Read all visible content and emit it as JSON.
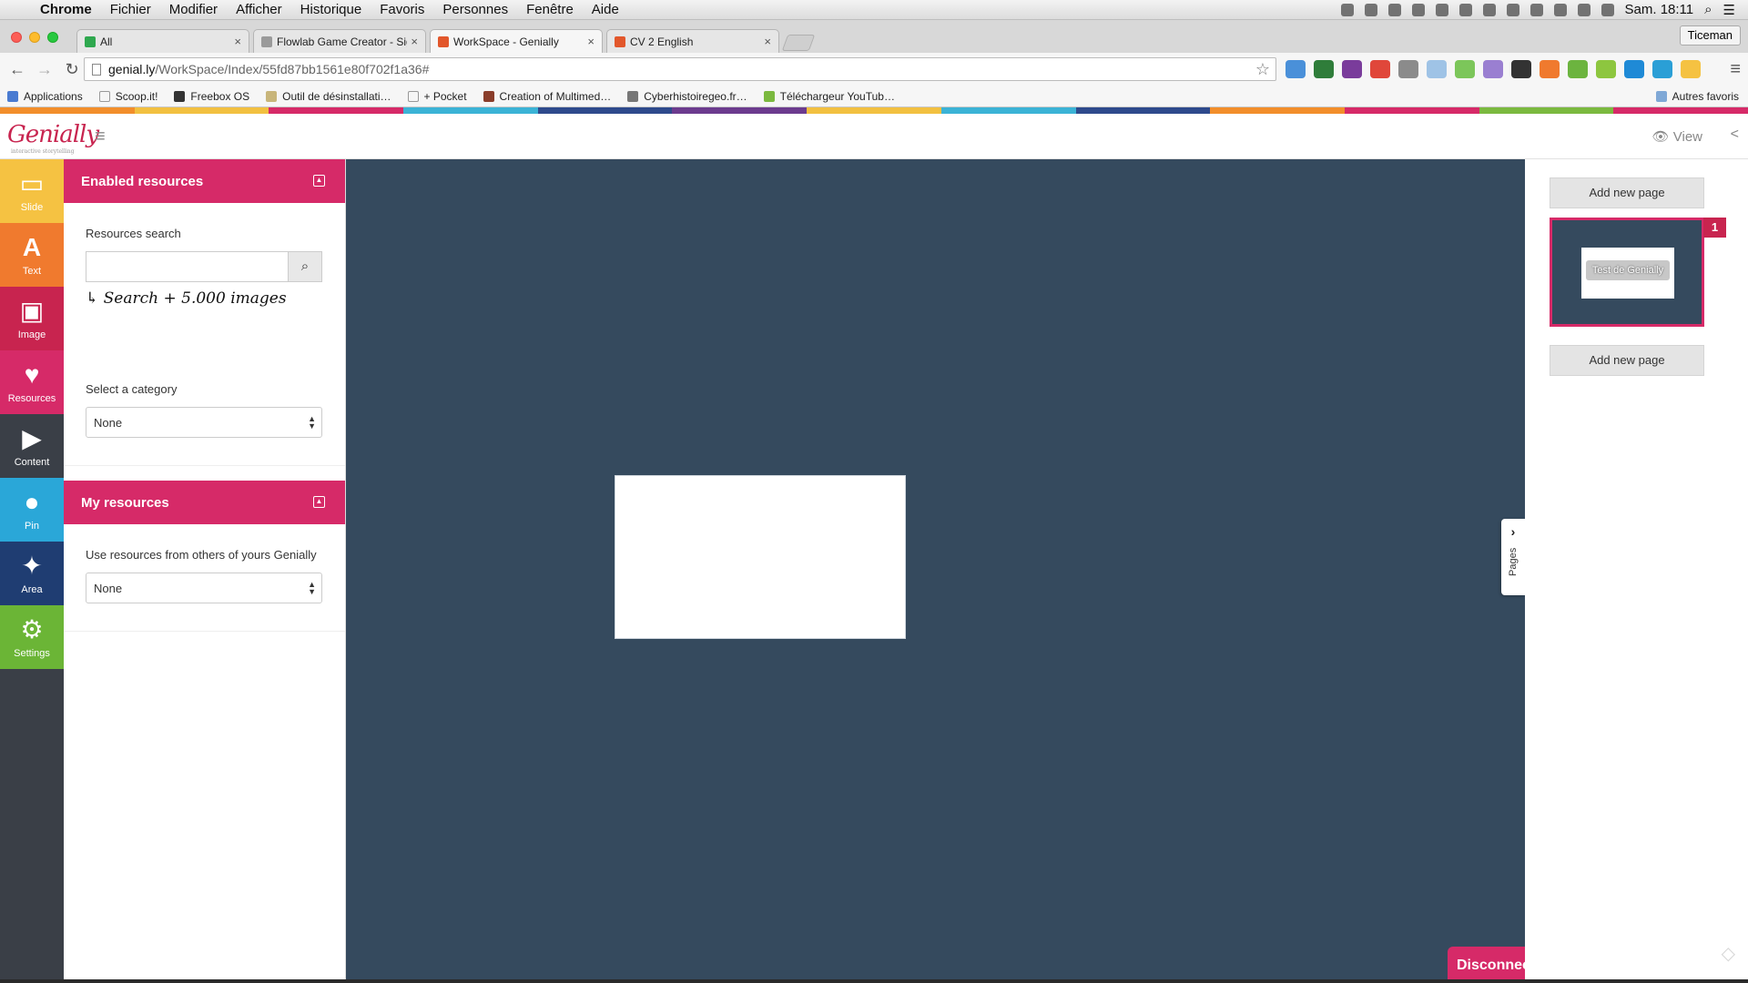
{
  "macos": {
    "menus": [
      "Chrome",
      "Fichier",
      "Modifier",
      "Afficher",
      "Historique",
      "Favoris",
      "Personnes",
      "Fenêtre",
      "Aide"
    ],
    "clock": "Sam. 18:11"
  },
  "browser": {
    "tabs": [
      {
        "label": "All",
        "favicon_color": "#2fa84f"
      },
      {
        "label": "Flowlab Game Creator - Sig",
        "favicon_color": "#9a9a9a"
      },
      {
        "label": "WorkSpace - Genially",
        "favicon_color": "#e2572b"
      },
      {
        "label": "CV 2 English",
        "favicon_color": "#e2572b"
      }
    ],
    "profile": "Ticeman",
    "url_host": "genial.ly",
    "url_path": "/WorkSpace/Index/55fd87bb1561e80f702f1a36#",
    "bookmarks": [
      {
        "label": "Applications",
        "color": "#4a7bd1"
      },
      {
        "label": "Scoop.it!",
        "color": "#ffffff"
      },
      {
        "label": "Freebox OS",
        "color": "#333333"
      },
      {
        "label": "Outil de désinstallati…",
        "color": "#c8b57a"
      },
      {
        "label": "+ Pocket",
        "color": "#ffffff"
      },
      {
        "label": "Creation of Multimed…",
        "color": "#8a3d2a"
      },
      {
        "label": "Cyberhistoiregeo.fr…",
        "color": "#777777"
      },
      {
        "label": "Téléchargeur YouTub…",
        "color": "#7bb93f"
      }
    ],
    "bookmarks_right": "Autres favoris"
  },
  "app": {
    "logo": "Genially",
    "logo_tagline": "interactive storytelling",
    "view_label": "View",
    "color_strip": [
      "#f28e2b",
      "#f2c040",
      "#d62a68",
      "#3bb3d6",
      "#2e4a8c",
      "#6c3b8e",
      "#f2c040",
      "#3bb3d6",
      "#2e4a8c",
      "#f28e2b",
      "#d62a68",
      "#7bb93f",
      "#d62a68"
    ],
    "rail": [
      {
        "label": "Slide",
        "icon": "▭",
        "color": "#f5c242"
      },
      {
        "label": "Text",
        "icon": "A",
        "color": "#f07a2e"
      },
      {
        "label": "Image",
        "icon": "▣",
        "color": "#c8244f"
      },
      {
        "label": "Resources",
        "icon": "♥",
        "color": "#d62a68"
      },
      {
        "label": "Content",
        "icon": "▶",
        "color": "#3a3f47"
      },
      {
        "label": "Pin",
        "icon": "●",
        "color": "#2aa7d8"
      },
      {
        "label": "Area",
        "icon": "✦",
        "color": "#1f3d72"
      },
      {
        "label": "Settings",
        "icon": "⚙",
        "color": "#6bb536"
      }
    ],
    "enabled_resources": {
      "title": "Enabled resources",
      "search_label": "Resources search",
      "search_value": "",
      "search_hint": "↳ Search + 5.000 images",
      "category_label": "Select a category",
      "category_value": "None"
    },
    "my_resources": {
      "title": "My resources",
      "description": "Use resources from others of yours Genially",
      "select_value": "None"
    },
    "pages": {
      "add_page_label": "Add new page",
      "add_page_label_2": "Add new page",
      "thumb_number": "1",
      "thumb_title": "Test de Genially",
      "toggle_label": "Pages"
    },
    "disconnect_label": "Disconnect"
  }
}
